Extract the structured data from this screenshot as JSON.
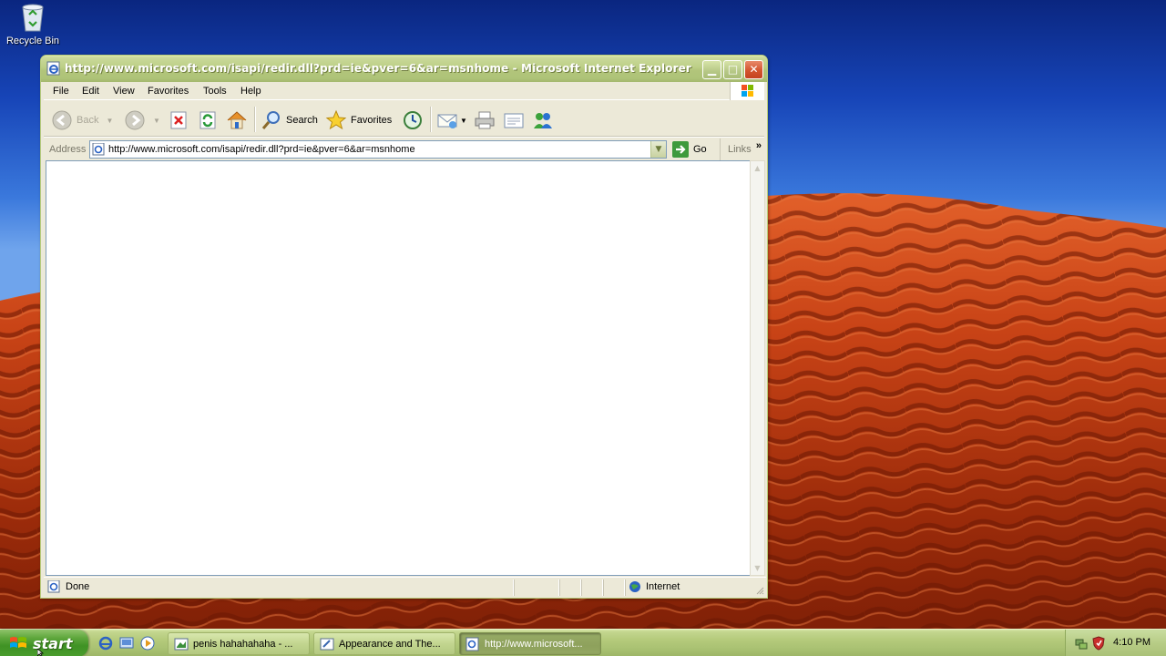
{
  "desktop": {
    "icons": [
      {
        "label": "Recycle Bin",
        "icon": "recycle-bin-icon"
      }
    ]
  },
  "window": {
    "title": "http://www.microsoft.com/isapi/redir.dll?prd=ie&pver=6&ar=msnhome - Microsoft Internet Explorer",
    "controls": {
      "minimize": "minimize-icon",
      "maximize": "maximize-icon",
      "close": "close-icon"
    },
    "menu": [
      "File",
      "Edit",
      "View",
      "Favorites",
      "Tools",
      "Help"
    ],
    "toolbar": {
      "back": "Back",
      "search": "Search",
      "favorites": "Favorites"
    },
    "address": {
      "label": "Address",
      "url": "http://www.microsoft.com/isapi/redir.dll?prd=ie&pver=6&ar=msnhome",
      "go": "Go",
      "links": "Links",
      "more": "»"
    },
    "status": {
      "text": "Done",
      "zone": "Internet"
    }
  },
  "taskbar": {
    "start": "start",
    "tasks": [
      {
        "label": "penis hahahahaha - ...",
        "icon": "paint-icon",
        "active": false
      },
      {
        "label": "Appearance and The...",
        "icon": "control-panel-icon",
        "active": false
      },
      {
        "label": "http://www.microsoft...",
        "icon": "ie-page-icon",
        "active": true
      }
    ],
    "clock": "4:10 PM"
  },
  "colors": {
    "titlebar": "#b4c880",
    "taskbar": "#b4ca7b",
    "start": "#4a9d2e",
    "close": "#d3542e"
  }
}
